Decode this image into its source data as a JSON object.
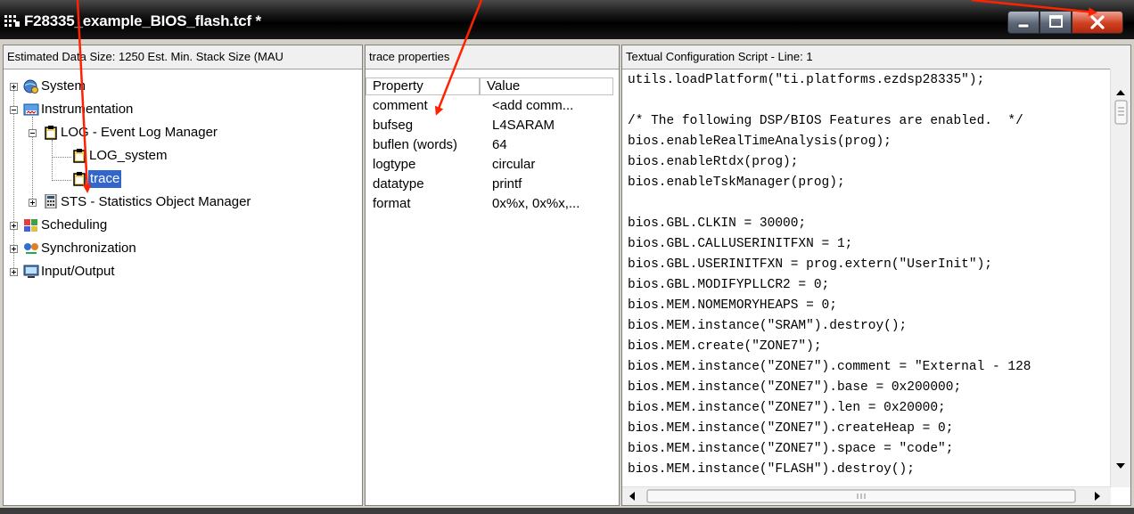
{
  "window": {
    "title": "F28335_example_BIOS_flash.tcf *"
  },
  "colors": {
    "selection": "#3366cc",
    "arrow": "#ff2200",
    "close": "#d04020"
  },
  "left_pane": {
    "header": "Estimated Data Size: 1250   Est. Min. Stack Size (MAU",
    "tree": [
      {
        "label": "System",
        "icon": "globe-gear-icon"
      },
      {
        "label": "Instrumentation",
        "icon": "instrumentation-icon"
      },
      {
        "label": "LOG - Event Log Manager",
        "icon": "clipboard-icon"
      },
      {
        "label": "LOG_system",
        "icon": "clipboard-icon"
      },
      {
        "label": "trace",
        "icon": "clipboard-icon"
      },
      {
        "label": "STS - Statistics Object Manager",
        "icon": "calculator-icon"
      },
      {
        "label": "Scheduling",
        "icon": "scheduling-icon"
      },
      {
        "label": "Synchronization",
        "icon": "sync-icon"
      },
      {
        "label": "Input/Output",
        "icon": "monitor-icon"
      }
    ]
  },
  "mid_pane": {
    "header": "trace properties",
    "col_property": "Property",
    "col_value": "Value",
    "rows": [
      {
        "property": "comment",
        "value": "<add comm..."
      },
      {
        "property": "bufseg",
        "value": "L4SARAM"
      },
      {
        "property": "buflen (words)",
        "value": "64"
      },
      {
        "property": "logtype",
        "value": "circular"
      },
      {
        "property": "datatype",
        "value": "printf"
      },
      {
        "property": "format",
        "value": "0x%x, 0x%x,..."
      }
    ]
  },
  "right_pane": {
    "header": "Textual Configuration Script - Line: 1",
    "lines": [
      "utils.loadPlatform(\"ti.platforms.ezdsp28335\");",
      "",
      "/* The following DSP/BIOS Features are enabled.  */",
      "bios.enableRealTimeAnalysis(prog);",
      "bios.enableRtdx(prog);",
      "bios.enableTskManager(prog);",
      "",
      "bios.GBL.CLKIN = 30000;",
      "bios.GBL.CALLUSERINITFXN = 1;",
      "bios.GBL.USERINITFXN = prog.extern(\"UserInit\");",
      "bios.GBL.MODIFYPLLCR2 = 0;",
      "bios.MEM.NOMEMORYHEAPS = 0;",
      "bios.MEM.instance(\"SRAM\").destroy();",
      "bios.MEM.create(\"ZONE7\");",
      "bios.MEM.instance(\"ZONE7\").comment = \"External - 128",
      "bios.MEM.instance(\"ZONE7\").base = 0x200000;",
      "bios.MEM.instance(\"ZONE7\").len = 0x20000;",
      "bios.MEM.instance(\"ZONE7\").createHeap = 0;",
      "bios.MEM.instance(\"ZONE7\").space = \"code\";",
      "bios.MEM.instance(\"FLASH\").destroy();"
    ]
  }
}
